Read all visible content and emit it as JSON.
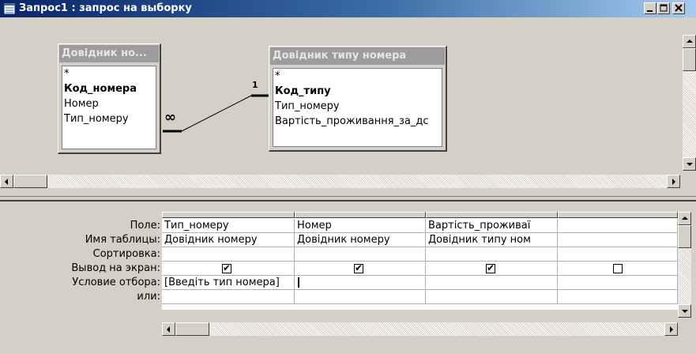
{
  "window": {
    "title": "Запрос1 : запрос на выборку",
    "controls": [
      "minimize",
      "maximize",
      "close"
    ]
  },
  "tables": [
    {
      "title": "Довідник но...",
      "fields": [
        "*",
        "Код_номера",
        "Номер",
        "Тип_номеру"
      ],
      "key_field": "Код_номера"
    },
    {
      "title": "Довідник типу номера",
      "fields": [
        "*",
        "Код_типу",
        "Тип_номеру",
        "Вартість_проживання_за_дс"
      ],
      "key_field": "Код_типу"
    }
  ],
  "relationship": {
    "many_symbol": "∞",
    "one_symbol": "1"
  },
  "grid": {
    "row_labels": [
      "Поле:",
      "Имя таблицы:",
      "Сортировка:",
      "Вывод на экран:",
      "Условие отбора:",
      "или:"
    ],
    "columns": [
      {
        "field": "Тип_номеру",
        "table": "Довідник номеру",
        "sort": "",
        "show": true,
        "criteria": "[Введіть тип номера]",
        "or": ""
      },
      {
        "field": "Номер",
        "table": "Довідник номеру",
        "sort": "",
        "show": true,
        "criteria": "",
        "or": ""
      },
      {
        "field": "Вартість_проживаї",
        "table": "Довідник типу ном",
        "sort": "",
        "show": true,
        "criteria": "",
        "or": ""
      },
      {
        "field": "",
        "table": "",
        "sort": "",
        "show": false,
        "criteria": "",
        "or": ""
      }
    ]
  },
  "colors": {
    "title_bar_start": "#0a246a",
    "title_bar_end": "#a6caf0",
    "face": "#d4d0c8",
    "inactive_caption": "#9c9c9c"
  }
}
